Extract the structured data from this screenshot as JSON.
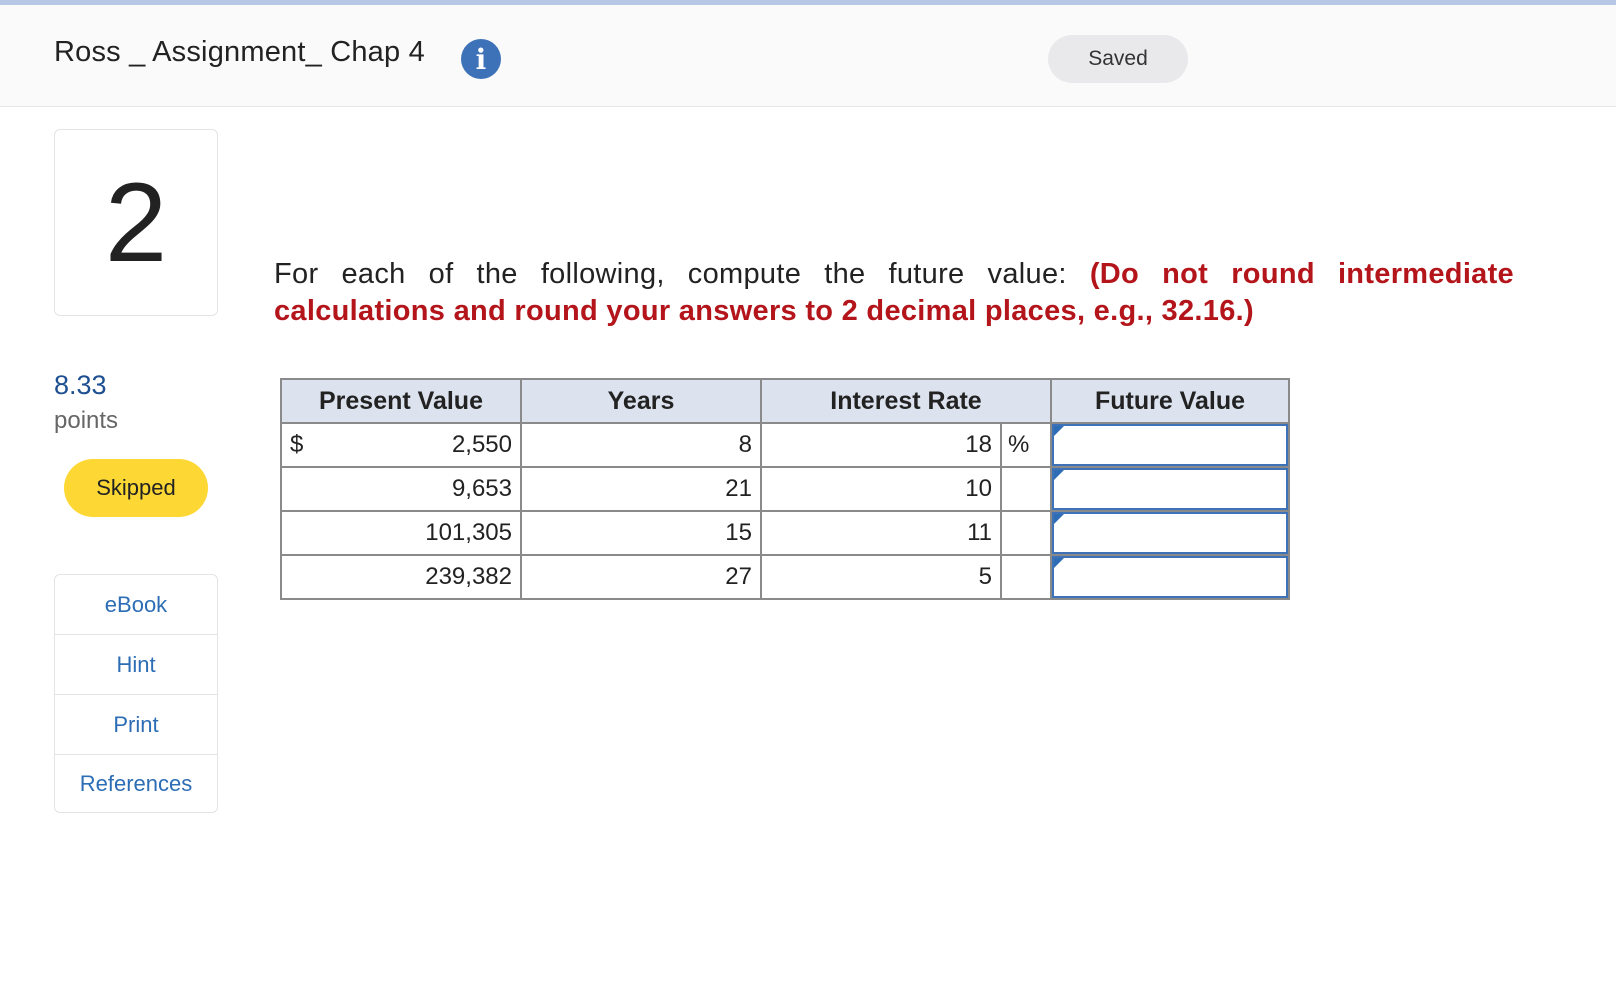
{
  "header": {
    "title": "Ross _ Assignment_ Chap 4",
    "info_icon": "info-icon",
    "saved_label": "Saved"
  },
  "question": {
    "number": "2",
    "points_value": "8.33",
    "points_label": "points",
    "status": "Skipped",
    "prompt_plain": "For each of the following, compute the future value: ",
    "prompt_instruction": "(Do not round intermediate calculations and round your answers to 2 decimal places, e.g., 32.16.)"
  },
  "side_menu": {
    "items": [
      {
        "label": "eBook"
      },
      {
        "label": "Hint"
      },
      {
        "label": "Print"
      },
      {
        "label": "References"
      }
    ]
  },
  "table": {
    "headers": [
      "Present Value",
      "Years",
      "Interest Rate",
      "Future Value"
    ],
    "currency_symbol": "$",
    "percent_symbol": "%",
    "rows": [
      {
        "present_value": "2,550",
        "years": "8",
        "interest_rate": "18",
        "future_value": ""
      },
      {
        "present_value": "9,653",
        "years": "21",
        "interest_rate": "10",
        "future_value": ""
      },
      {
        "present_value": "101,305",
        "years": "15",
        "interest_rate": "11",
        "future_value": ""
      },
      {
        "present_value": "239,382",
        "years": "27",
        "interest_rate": "5",
        "future_value": ""
      }
    ]
  },
  "colors": {
    "accent": "#3d72b8",
    "instruction_red": "#b3151b",
    "skipped_yellow": "#fdd835",
    "header_fill": "#dde3ee"
  }
}
